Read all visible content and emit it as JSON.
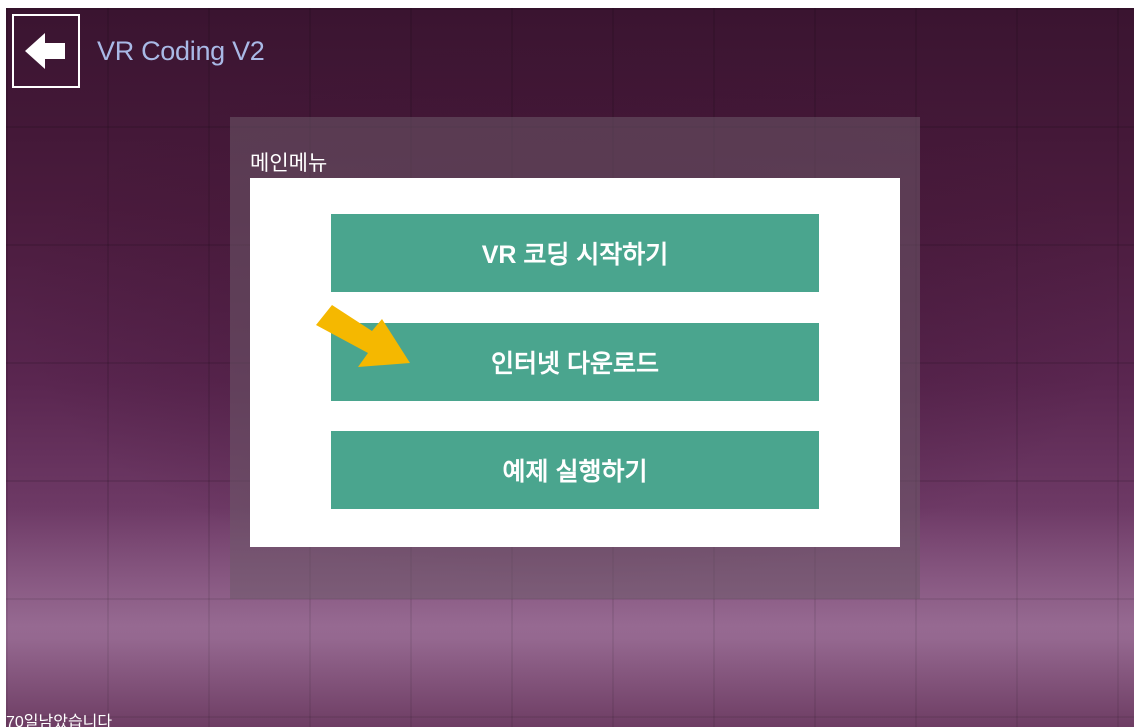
{
  "app": {
    "title": "VR Coding V2"
  },
  "icons": {
    "back": "arrow-left-icon",
    "pointer": "arrow-pointer-icon"
  },
  "colors": {
    "accent_button": "#4aa58e",
    "title_text": "#a9b9e6",
    "pointer_arrow": "#f5b800"
  },
  "menu": {
    "title": "메인메뉴",
    "items": [
      {
        "label": "VR 코딩 시작하기"
      },
      {
        "label": "인터넷 다운로드"
      },
      {
        "label": "예제 실행하기"
      }
    ]
  },
  "footer": {
    "status_text": "70일남았습니다"
  }
}
